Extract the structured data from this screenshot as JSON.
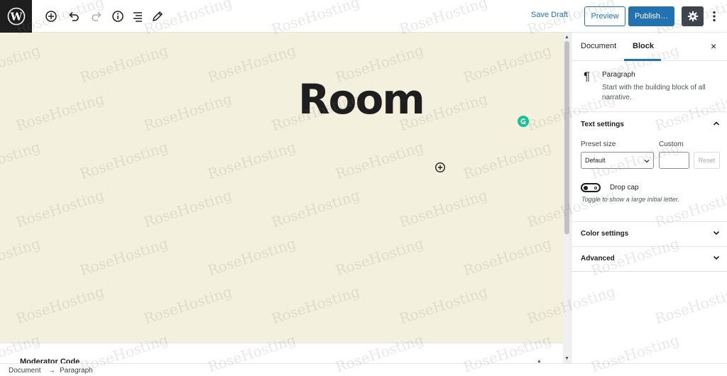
{
  "toolbar": {
    "save_draft": "Save Draft",
    "preview": "Preview",
    "publish": "Publish…",
    "icons": [
      "wordpress-logo",
      "add-block",
      "undo",
      "redo",
      "info",
      "list-view",
      "edit-tools",
      "settings-gear",
      "more-menu"
    ]
  },
  "editor": {
    "title": "Room",
    "metabox_title": "Moderator Code"
  },
  "sidebar": {
    "tabs": [
      "Document",
      "Block"
    ],
    "active_tab": "Block",
    "close": "×",
    "block": {
      "name": "Paragraph",
      "description": "Start with the building block of all narrative."
    },
    "text_settings": {
      "title": "Text settings",
      "preset_label": "Preset size",
      "preset_value": "Default",
      "custom_label": "Custom",
      "reset": "Reset",
      "drop_cap_label": "Drop cap",
      "drop_cap_help": "Toggle to show a large initial letter.",
      "drop_cap_on": false
    },
    "color_settings": "Color settings",
    "advanced": "Advanced"
  },
  "breadcrumb": {
    "items": [
      "Document",
      "Paragraph"
    ],
    "separator": "→"
  },
  "watermark": "RoseHosting",
  "colors": {
    "accent": "#2271b1",
    "canvas": "#f3f0de",
    "dark": "#1e1e1e",
    "grammarly": "#15c39a"
  }
}
